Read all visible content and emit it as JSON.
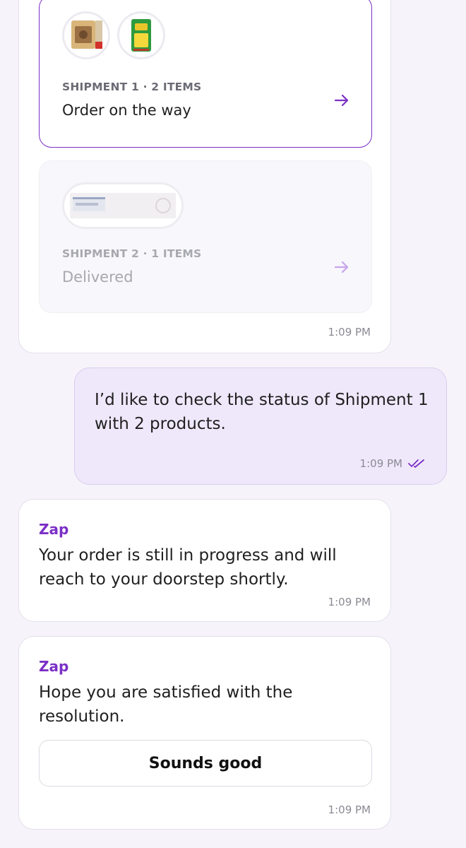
{
  "shipments": [
    {
      "label": "SHIPMENT 1 · 2 ITEMS",
      "status": "Order on the way",
      "products": [
        "product-pack-icon",
        "fortune-pack-icon"
      ]
    },
    {
      "label": "SHIPMENT 2 · 1 ITEMS",
      "status": "Delivered",
      "products": [
        "nipcare-box-icon"
      ]
    }
  ],
  "shipments_time": "1:09 PM",
  "user_message": {
    "text": "I’d like to check the status of Shipment 1 with 2 products.",
    "time": "1:09 PM",
    "read_icon": "double-check-icon"
  },
  "bot_messages": [
    {
      "sender": "Zap",
      "text": "Your order is still in progress and will reach to your doorstep shortly.",
      "time": "1:09 PM"
    },
    {
      "sender": "Zap",
      "text": "Hope you are satisfied with the resolution.",
      "button_label": "Sounds good",
      "time": "1:09 PM"
    }
  ],
  "colors": {
    "accent": "#7b2fc6",
    "user_bubble": "#efe8fb",
    "background": "#f6f4fa"
  }
}
